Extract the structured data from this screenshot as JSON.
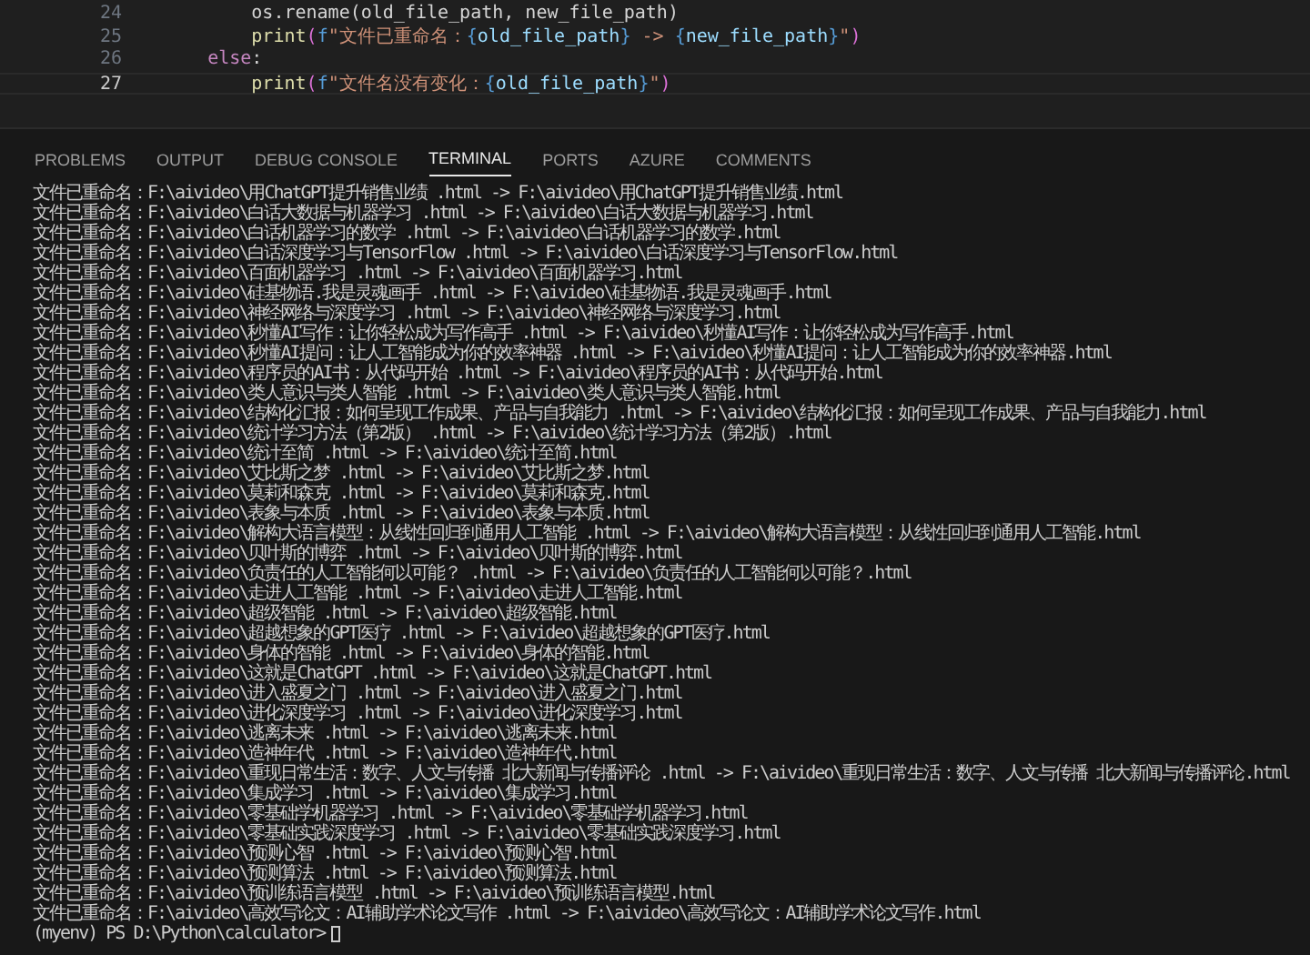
{
  "editor": {
    "lines": [
      {
        "number": "24",
        "current": false,
        "tokens": [
          {
            "text": "        os.rename(old_file_path, new_file_path)",
            "kind": "plain"
          }
        ]
      },
      {
        "number": "25",
        "current": false,
        "tokens": [
          {
            "text": "        print",
            "kind": "function"
          },
          {
            "text": "(",
            "kind": "bracket"
          },
          {
            "text": "f",
            "kind": "keyword"
          },
          {
            "text": "\"文件已重命名：",
            "kind": "string"
          },
          {
            "text": "{",
            "kind": "brace"
          },
          {
            "text": "old_file_path",
            "kind": "variable"
          },
          {
            "text": "}",
            "kind": "brace"
          },
          {
            "text": " -> ",
            "kind": "string"
          },
          {
            "text": "{",
            "kind": "brace"
          },
          {
            "text": "new_file_path",
            "kind": "variable"
          },
          {
            "text": "}",
            "kind": "brace"
          },
          {
            "text": "\"",
            "kind": "string"
          },
          {
            "text": ")",
            "kind": "bracket"
          }
        ]
      },
      {
        "number": "26",
        "current": false,
        "tokens": [
          {
            "text": "    else",
            "kind": "control"
          },
          {
            "text": ":",
            "kind": "plain"
          }
        ]
      },
      {
        "number": "27",
        "current": true,
        "tokens": [
          {
            "text": "        print",
            "kind": "function"
          },
          {
            "text": "(",
            "kind": "bracket"
          },
          {
            "text": "f",
            "kind": "keyword"
          },
          {
            "text": "\"文件名没有变化：",
            "kind": "string"
          },
          {
            "text": "{",
            "kind": "brace"
          },
          {
            "text": "old_file_path",
            "kind": "variable"
          },
          {
            "text": "}",
            "kind": "brace"
          },
          {
            "text": "\"",
            "kind": "string"
          },
          {
            "text": ")",
            "kind": "bracket"
          }
        ]
      }
    ]
  },
  "panel": {
    "tabs": [
      {
        "label": "PROBLEMS",
        "selected": false
      },
      {
        "label": "OUTPUT",
        "selected": false
      },
      {
        "label": "DEBUG CONSOLE",
        "selected": false
      },
      {
        "label": "TERMINAL",
        "selected": true
      },
      {
        "label": "PORTS",
        "selected": false
      },
      {
        "label": "AZURE",
        "selected": false
      },
      {
        "label": "COMMENTS",
        "selected": false
      }
    ],
    "terminal": {
      "lines": [
        "文件已重命名：F:\\aivideo\\用ChatGPT提升销售业绩 .html -> F:\\aivideo\\用ChatGPT提升销售业绩.html",
        "文件已重命名：F:\\aivideo\\白话大数据与机器学习 .html -> F:\\aivideo\\白话大数据与机器学习.html",
        "文件已重命名：F:\\aivideo\\白话机器学习的数学 .html -> F:\\aivideo\\白话机器学习的数学.html",
        "文件已重命名：F:\\aivideo\\白话深度学习与TensorFlow .html -> F:\\aivideo\\白话深度学习与TensorFlow.html",
        "文件已重命名：F:\\aivideo\\百面机器学习 .html -> F:\\aivideo\\百面机器学习.html",
        "文件已重命名：F:\\aivideo\\硅基物语.我是灵魂画手 .html -> F:\\aivideo\\硅基物语.我是灵魂画手.html",
        "文件已重命名：F:\\aivideo\\神经网络与深度学习 .html -> F:\\aivideo\\神经网络与深度学习.html",
        "文件已重命名：F:\\aivideo\\秒懂AI写作：让你轻松成为写作高手 .html -> F:\\aivideo\\秒懂AI写作：让你轻松成为写作高手.html",
        "文件已重命名：F:\\aivideo\\秒懂AI提问：让人工智能成为你的效率神器 .html -> F:\\aivideo\\秒懂AI提问：让人工智能成为你的效率神器.html",
        "文件已重命名：F:\\aivideo\\程序员的AI书：从代码开始 .html -> F:\\aivideo\\程序员的AI书：从代码开始.html",
        "文件已重命名：F:\\aivideo\\类人意识与类人智能 .html -> F:\\aivideo\\类人意识与类人智能.html",
        "文件已重命名：F:\\aivideo\\结构化汇报：如何呈现工作成果、产品与自我能力 .html -> F:\\aivideo\\结构化汇报：如何呈现工作成果、产品与自我能力.html",
        "文件已重命名：F:\\aivideo\\统计学习方法（第2版） .html -> F:\\aivideo\\统计学习方法（第2版）.html",
        "文件已重命名：F:\\aivideo\\统计至简 .html -> F:\\aivideo\\统计至简.html",
        "文件已重命名：F:\\aivideo\\艾比斯之梦 .html -> F:\\aivideo\\艾比斯之梦.html",
        "文件已重命名：F:\\aivideo\\莫莉和森克 .html -> F:\\aivideo\\莫莉和森克.html",
        "文件已重命名：F:\\aivideo\\表象与本质 .html -> F:\\aivideo\\表象与本质.html",
        "文件已重命名：F:\\aivideo\\解构大语言模型：从线性回归到通用人工智能 .html -> F:\\aivideo\\解构大语言模型：从线性回归到通用人工智能.html",
        "文件已重命名：F:\\aivideo\\贝叶斯的博弈 .html -> F:\\aivideo\\贝叶斯的博弈.html",
        "文件已重命名：F:\\aivideo\\负责任的人工智能何以可能？ .html -> F:\\aivideo\\负责任的人工智能何以可能？.html",
        "文件已重命名：F:\\aivideo\\走进人工智能 .html -> F:\\aivideo\\走进人工智能.html",
        "文件已重命名：F:\\aivideo\\超级智能 .html -> F:\\aivideo\\超级智能.html",
        "文件已重命名：F:\\aivideo\\超越想象的GPT医疗 .html -> F:\\aivideo\\超越想象的GPT医疗.html",
        "文件已重命名：F:\\aivideo\\身体的智能 .html -> F:\\aivideo\\身体的智能.html",
        "文件已重命名：F:\\aivideo\\这就是ChatGPT .html -> F:\\aivideo\\这就是ChatGPT.html",
        "文件已重命名：F:\\aivideo\\进入盛夏之门 .html -> F:\\aivideo\\进入盛夏之门.html",
        "文件已重命名：F:\\aivideo\\进化深度学习 .html -> F:\\aivideo\\进化深度学习.html",
        "文件已重命名：F:\\aivideo\\逃离未来 .html -> F:\\aivideo\\逃离未来.html",
        "文件已重命名：F:\\aivideo\\造神年代 .html -> F:\\aivideo\\造神年代.html",
        "文件已重命名：F:\\aivideo\\重现日常生活：数字、人文与传播 北大新闻与传播评论 .html -> F:\\aivideo\\重现日常生活：数字、人文与传播 北大新闻与传播评论.html",
        "文件已重命名：F:\\aivideo\\集成学习 .html -> F:\\aivideo\\集成学习.html",
        "文件已重命名：F:\\aivideo\\零基础学机器学习 .html -> F:\\aivideo\\零基础学机器学习.html",
        "文件已重命名：F:\\aivideo\\零基础实践深度学习 .html -> F:\\aivideo\\零基础实践深度学习.html",
        "文件已重命名：F:\\aivideo\\预测心智 .html -> F:\\aivideo\\预测心智.html",
        "文件已重命名：F:\\aivideo\\预测算法 .html -> F:\\aivideo\\预测算法.html",
        "文件已重命名：F:\\aivideo\\预训练语言模型 .html -> F:\\aivideo\\预训练语言模型.html",
        "文件已重命名：F:\\aivideo\\高效写论文：AI辅助学术论文写作 .html -> F:\\aivideo\\高效写论文：AI辅助学术论文写作.html"
      ],
      "prompt": "(myenv) PS D:\\Python\\calculator>"
    }
  }
}
